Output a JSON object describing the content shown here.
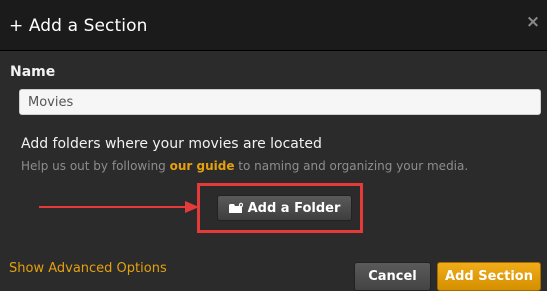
{
  "dialog": {
    "title": "+ Add a Section",
    "close_glyph": "×"
  },
  "name_field": {
    "label": "Name",
    "value": "Movies"
  },
  "folders": {
    "heading": "Add folders where your movies are located",
    "help_prefix": "Help us out by following ",
    "help_link": "our guide",
    "help_suffix": " to naming and organizing your media.",
    "add_folder_label": "Add a Folder",
    "add_folder_icon": "folder-plus-icon"
  },
  "footer": {
    "advanced_label": "Show Advanced Options",
    "cancel_label": "Cancel",
    "add_section_label": "Add Section"
  },
  "colors": {
    "accent": "#e5a00d",
    "annotation": "#e53a3a",
    "background": "#2b2b2b",
    "titlebar": "#1b1b1b"
  }
}
